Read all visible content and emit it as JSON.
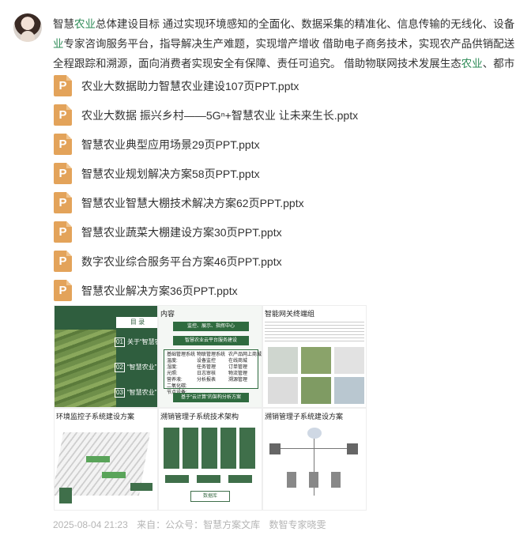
{
  "post": {
    "line1_parts": [
      "智慧",
      "农业",
      "总体建设目标  通过实现环境感知的全面化、数据采集的精准化、信息传输的无线化、设备"
    ],
    "line2_parts": [
      "业",
      "专家咨询服务平台，指导解决生产难题，实现增产增收  借助电子商务技术，实现农产品供销配送"
    ],
    "line3_parts": [
      "全程跟踪和溯源，面向消费者实现安全有保障、责任可追究。  借助物联网技术发展生态",
      "农业",
      "、都市"
    ]
  },
  "files": [
    {
      "icon": "P",
      "name": "农业大数据助力智慧农业建设107页PPT.pptx"
    },
    {
      "icon": "P",
      "name": "农业大数据 振兴乡村——5Gⁿ+智慧农业 让未来生长.pptx"
    },
    {
      "icon": "P",
      "name": "智慧农业典型应用场景29页PPT.pptx"
    },
    {
      "icon": "P",
      "name": "智慧农业规划解决方案58页PPT.pptx"
    },
    {
      "icon": "P",
      "name": "智慧农业智慧大棚技术解决方案62页PPT.pptx"
    },
    {
      "icon": "P",
      "name": "智慧农业蔬菜大棚建设方案30页PPT.pptx"
    },
    {
      "icon": "P",
      "name": "数字农业综合服务平台方案46页PPT.pptx"
    },
    {
      "icon": "P",
      "name": "智慧农业解决方案36页PPT.pptx"
    }
  ],
  "thumbs": {
    "t1": {
      "mulu": "目    录",
      "items": [
        "关于“智慧农",
        "“智慧农业”",
        "“智慧农业”"
      ],
      "nums": [
        "01",
        "02",
        "03"
      ]
    },
    "t2": {
      "title": "内容",
      "top_bar": "监控、展示、指挥中心",
      "mid_bar": "智慧农业云平台服务建设",
      "col1": "基础管理系统\n温度:\n湿度:\n光照:\n营养液:\n二氧化碳:\n节点设备:",
      "col2": "物联管理系统\n设备监控\n任务管理\n日志审核\n分析报表",
      "col3": "农产品网上商城\n在线商城\n订单管理\n物流管理\n溯源管理",
      "bottom_bar": "基于“云计算”的架构分析方案"
    },
    "t3": {
      "title": "智能网关终端组"
    },
    "t4": {
      "title": "环境监控子系统建设方案"
    },
    "t5": {
      "title": "溯销管理子系统技术架构",
      "bottom_box": "数据库"
    },
    "t6": {
      "title": "溯销管理子系统建设方案"
    }
  },
  "meta": {
    "datetime": "2025-08-04 21:23",
    "source_label": "来自：公众号：智慧方案文库",
    "extra": "数智专家晓雯"
  },
  "colors": {
    "accent": "#2e8b57",
    "file_icon": "#e3a35a",
    "deep_green": "#2f5e3e",
    "meta": "#b5b5b5"
  }
}
